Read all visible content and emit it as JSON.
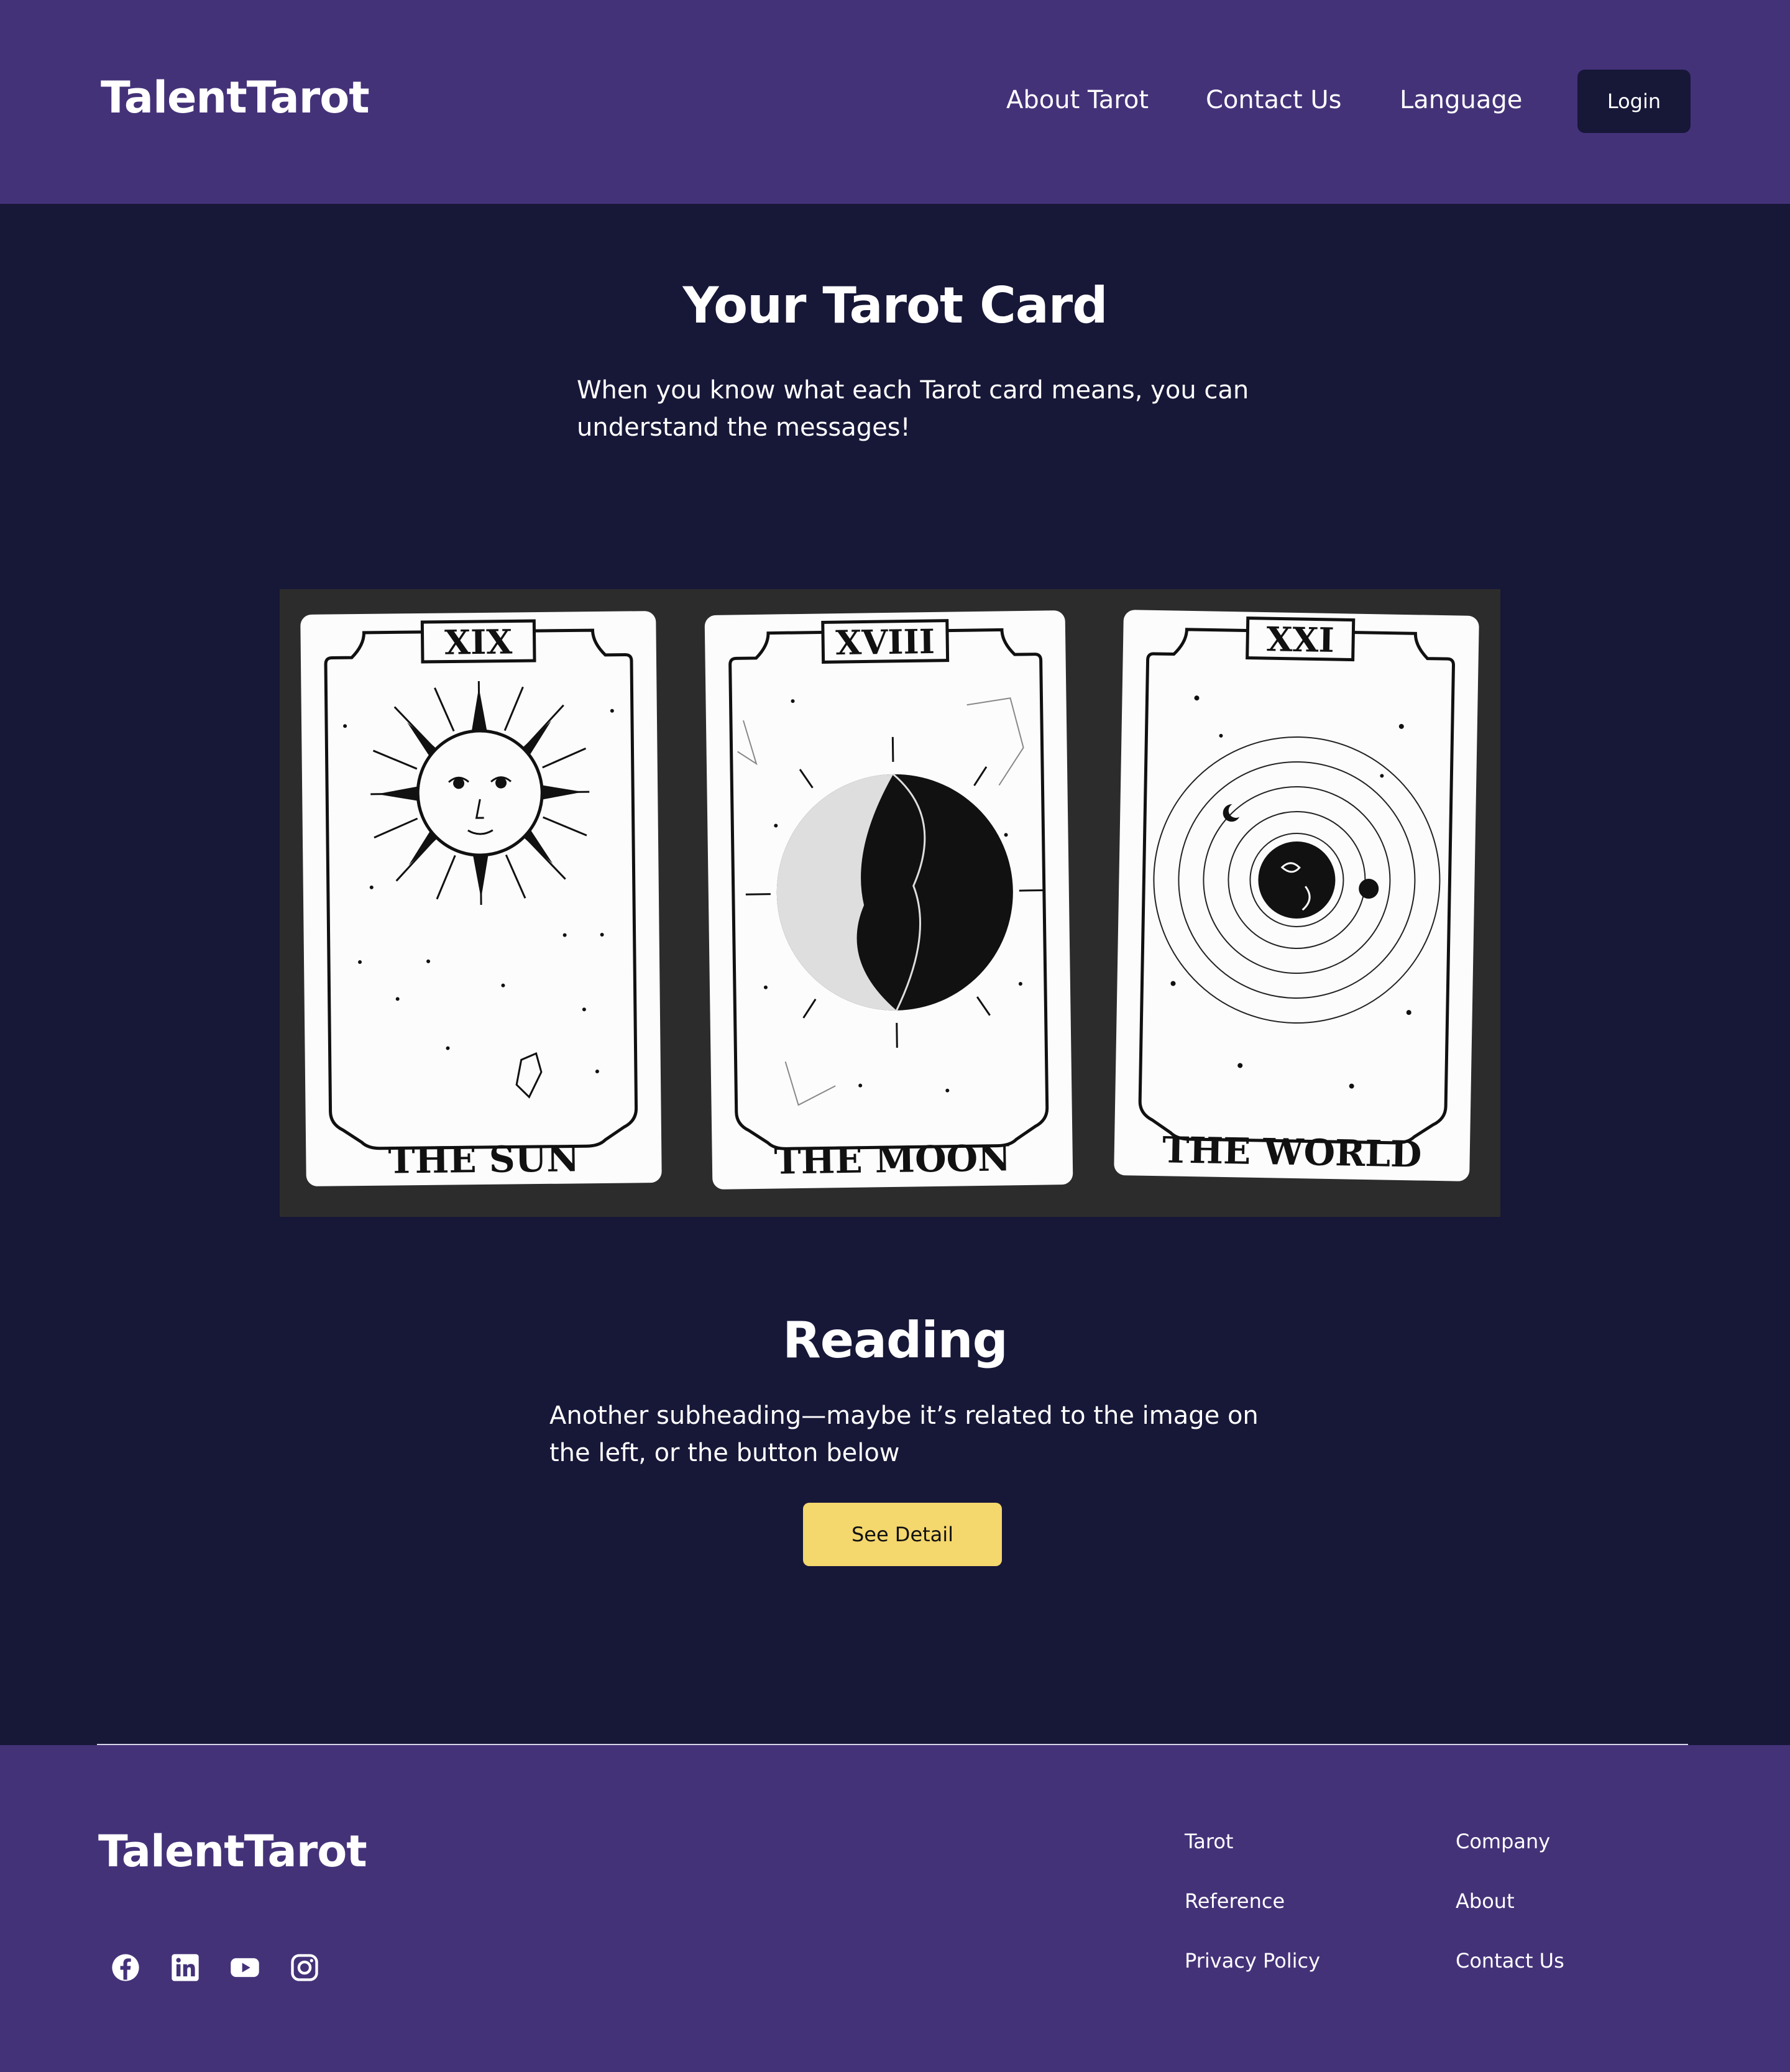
{
  "header": {
    "brand": "TalentTarot",
    "nav": [
      "About Tarot",
      "Contact Us",
      "Language"
    ],
    "login_label": "Login"
  },
  "hero": {
    "title": "Your Tarot Card",
    "subtitle": "When you know what each Tarot card means, you can understand the messages!"
  },
  "cards": [
    {
      "numeral": "XIX",
      "name": "THE SUN",
      "icon": "sun-icon"
    },
    {
      "numeral": "XVIII",
      "name": "THE MOON",
      "icon": "moon-icon"
    },
    {
      "numeral": "XXI",
      "name": "THE WORLD",
      "icon": "world-icon"
    }
  ],
  "reading": {
    "title": "Reading",
    "subtitle": "Another subheading—maybe it’s related to the image on the left, or the button below",
    "button_label": "See Detail"
  },
  "footer": {
    "brand": "TalentTarot",
    "social": [
      "facebook-icon",
      "linkedin-icon",
      "youtube-icon",
      "instagram-icon"
    ],
    "col1": [
      "Tarot",
      "Reference",
      "Privacy Policy"
    ],
    "col2": [
      "Company",
      "About",
      "Contact Us"
    ]
  },
  "colors": {
    "header_bg": "#443279",
    "page_bg": "#171738",
    "button_yellow": "#f4d76d"
  }
}
